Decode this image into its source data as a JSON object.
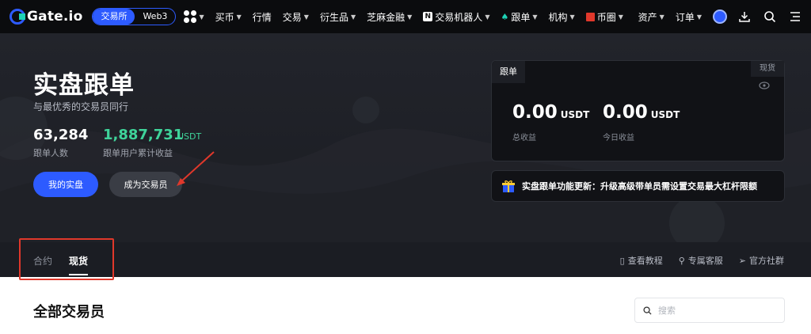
{
  "nav": {
    "logo": "Gate.io",
    "mode_active": "交易所",
    "mode_other": "Web3",
    "items": [
      {
        "label": "买币",
        "caret": true
      },
      {
        "label": "行情",
        "caret": false
      },
      {
        "label": "交易",
        "caret": true
      },
      {
        "label": "衍生品",
        "caret": true
      },
      {
        "label": "芝麻金融",
        "caret": true
      },
      {
        "label": "交易机器人",
        "caret": true
      },
      {
        "label": "跟单",
        "caret": true
      },
      {
        "label": "机构",
        "caret": true
      },
      {
        "label": "币圈",
        "caret": true
      }
    ],
    "right_items": [
      {
        "label": "资产"
      },
      {
        "label": "订单"
      }
    ],
    "icons": [
      "apps-icon",
      "avatar-icon",
      "download-icon",
      "search-icon",
      "menu-icon"
    ]
  },
  "hero": {
    "title": "实盘跟单",
    "subtitle": "与最优秀的交易员同行",
    "followers_value": "63,284",
    "followers_label": "跟单人数",
    "profit_value": "1,887,731",
    "profit_unit": "USDT",
    "profit_label": "跟单用户累计收益",
    "btn_my": "我的实盘",
    "btn_become": "成为交易员"
  },
  "card": {
    "tab": "跟单",
    "spot_tag": "现货",
    "total_value": "0.00",
    "total_unit": "USDT",
    "total_label": "总收益",
    "today_value": "0.00",
    "today_unit": "USDT",
    "today_label": "今日收益"
  },
  "notice": {
    "text": "实盘跟单功能更新：升级高级带单员需设置交易最大杠杆限额"
  },
  "tabs": {
    "contract": "合约",
    "spot": "现货",
    "links": [
      "查看教程",
      "专属客服",
      "官方社群"
    ]
  },
  "main": {
    "section_title": "全部交易员",
    "search_placeholder": "搜索"
  },
  "colors": {
    "accent": "#2d5bff",
    "profit": "#3fd39a",
    "highlight": "#e0382b"
  }
}
